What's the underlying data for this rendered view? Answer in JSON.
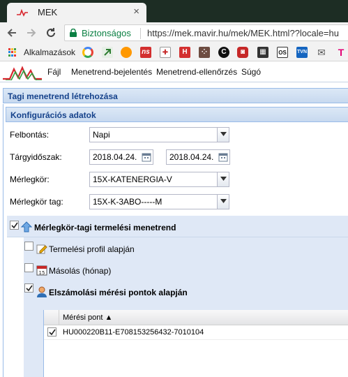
{
  "browser": {
    "tab_title": "MEK",
    "close_glyph": "×",
    "secure_label": "Biztonságos",
    "url": "https://mek.mavir.hu/mek/MEK.html??locale=hu",
    "apps_label": "Alkalmazások",
    "bookmark_icons": [
      "google-icon",
      "bookmark-arrow-icon",
      "bookmark-orange-circle-icon",
      "bookmark-ns-icon",
      "bookmark-cross-icon",
      "bookmark-h-icon",
      "bookmark-dots-icon",
      "bookmark-c-icon",
      "bookmark-pdf-icon",
      "bookmark-film-icon",
      "bookmark-os-icon",
      "bookmark-tvn-icon",
      "bookmark-mail-icon",
      "telekom-icon"
    ]
  },
  "menu": {
    "items": [
      "Fájl",
      "Menetrend-bejelentés",
      "Menetrend-ellenőrzés",
      "Súgó"
    ]
  },
  "panel": {
    "title": "Tagi menetrend létrehozása",
    "config_title": "Konfigurációs adatok"
  },
  "form": {
    "resolution_label": "Felbontás:",
    "resolution_value": "Napi",
    "period_label": "Tárgyidőszak:",
    "period_from": "2018.04.24.",
    "period_to": "2018.04.24.",
    "balance_group_label": "Mérlegkör:",
    "balance_group_value": "15X-KATENERGIA-V",
    "member_label": "Mérlegkör tag:",
    "member_value": "15X-K-3ABO-----M"
  },
  "tree": {
    "root_label": "Mérlegkör-tagi termelési menetrend",
    "root_checked": true,
    "children": [
      {
        "label": "Termelési profil alapján",
        "checked": false,
        "bold": false,
        "icon": "edit-profile-icon"
      },
      {
        "label": "Másolás (hónap)",
        "checked": false,
        "bold": false,
        "icon": "calendar-icon"
      },
      {
        "label": "Elszámolási mérési pontok alapján",
        "checked": true,
        "bold": true,
        "icon": "user-meter-icon"
      }
    ],
    "calendar_day": "15"
  },
  "grid": {
    "column_title": "Mérési pont ▲",
    "rows": [
      {
        "checked": true,
        "value": "HU000220B11-E708153256432-7010104"
      }
    ]
  },
  "colors": {
    "panel_header": "#15428b",
    "tree_background": "#dfe8f6",
    "secure_green": "#0b8043",
    "logo_red": "#d8262e",
    "logo_green": "#2e9c3e"
  }
}
